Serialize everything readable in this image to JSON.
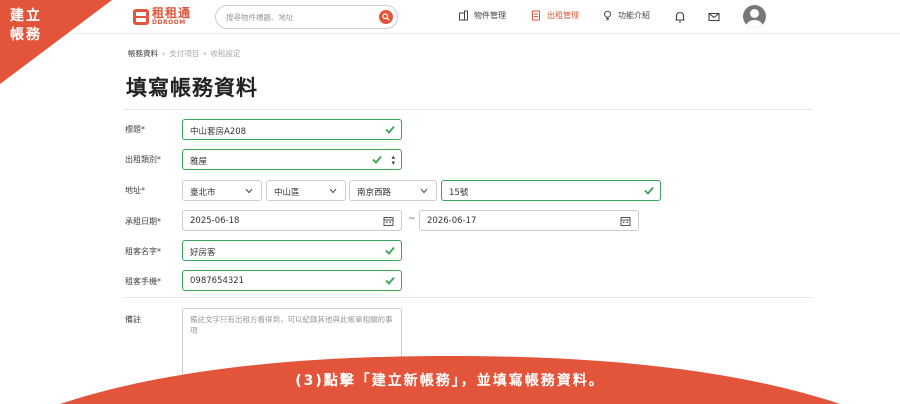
{
  "corner_ribbon": {
    "line1": "建立",
    "line2": "帳務",
    "color": "#e2553b"
  },
  "header": {
    "logo": {
      "text_cn": "租租通",
      "text_en": "DDROOM"
    },
    "search": {
      "placeholder": "搜尋物件標題、地址"
    },
    "nav": [
      {
        "label": "物件管理",
        "icon": "building-icon"
      },
      {
        "label": "出租管理",
        "icon": "document-icon",
        "active": true
      },
      {
        "label": "功能介紹",
        "icon": "lightbulb-icon"
      }
    ]
  },
  "breadcrumb": [
    "帳務資料",
    "支付項目",
    "收租設定"
  ],
  "page": {
    "title": "填寫帳務資料"
  },
  "form": {
    "title": {
      "label": "標題*",
      "value": "中山套房A208"
    },
    "rent_type": {
      "label": "出租類別*",
      "value": "雅屋"
    },
    "address": {
      "label": "地址*",
      "city": "臺北市",
      "district": "中山區",
      "road": "南京西路",
      "number": "15號"
    },
    "period": {
      "label": "承租日期*",
      "start": "2025-06-18",
      "separator": "~",
      "end": "2026-06-17"
    },
    "tenant_name": {
      "label": "租客名字*",
      "value": "好房客"
    },
    "tenant_phone": {
      "label": "租客手機*",
      "value": "0987654321"
    },
    "note": {
      "label": "備註",
      "placeholder": "備註文字只有出租方看得到，可以紀錄其他與此帳單相關的事項"
    }
  },
  "banner": {
    "text": "(3)點擊「建立新帳務」，並填寫帳務資料。",
    "color": "#e2553b"
  },
  "colors": {
    "accent": "#e2553b",
    "valid": "#3aa457"
  }
}
